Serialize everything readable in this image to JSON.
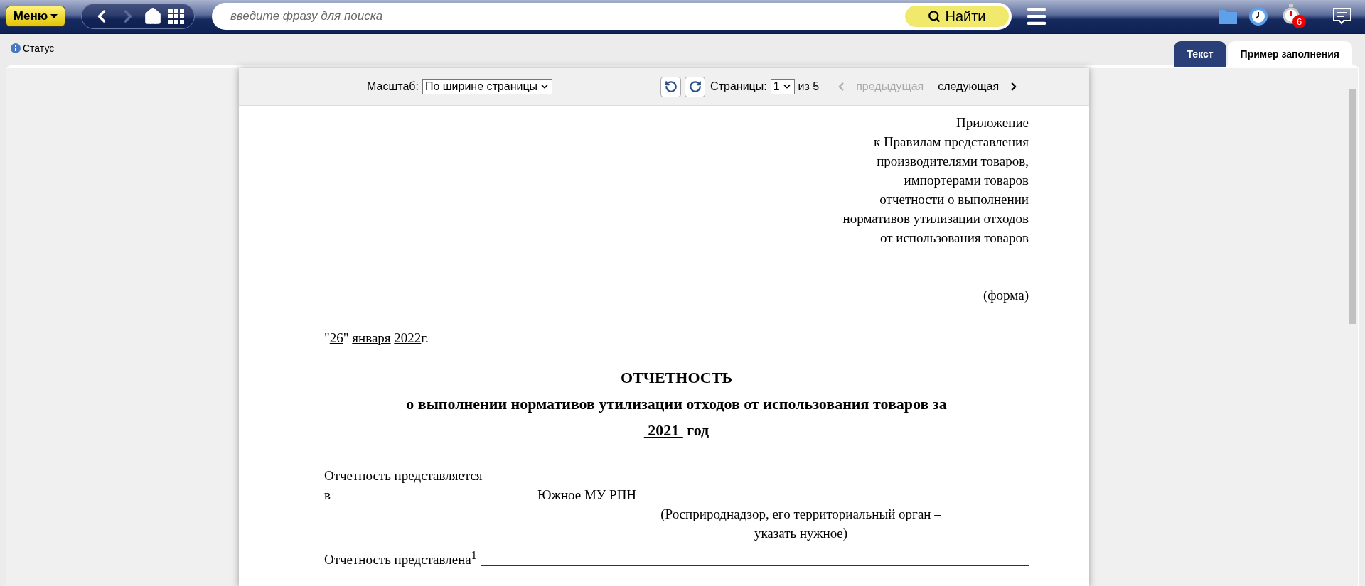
{
  "topbar": {
    "menu_button": "Меню",
    "search": {
      "placeholder": "введите фразу для поиска"
    },
    "search_button": "Найти",
    "timer_badge": "6"
  },
  "status_link": "Статус",
  "tabs": [
    {
      "label": "Текст",
      "selected": false
    },
    {
      "label": "Пример заполнения",
      "selected": true
    }
  ],
  "viewer_toolbar": {
    "zoom_label": "Масштаб:",
    "zoom_value": "По ширине страницы",
    "pages_label": "Страницы:",
    "page_value": "1",
    "page_total": "из 5",
    "prev": {
      "label": "предыдущая",
      "disabled": true
    },
    "next": {
      "label": "следующая",
      "disabled": false
    }
  },
  "document": {
    "appendix_lines": [
      "Приложение",
      "к Правилам представления",
      "производителями товаров,",
      "импортерами товаров",
      "отчетности о выполнении",
      "нормативов утилизации отходов",
      "от использования товаров"
    ],
    "form_label": "(форма)",
    "date_parts": [
      {
        "text": "\"",
        "underlined": false
      },
      {
        "text": "26",
        "underlined": true
      },
      {
        "text": "\" ",
        "underlined": false
      },
      {
        "text": "января",
        "underlined": true
      },
      {
        "text": "2022",
        "underlined": true
      },
      {
        "text": "г.",
        "underlined": false
      }
    ],
    "title": "ОТЧЕТНОСТЬ",
    "subtitle": "о выполнении нормативов утилизации отходов от использования товаров за",
    "year_parts": [
      {
        "text": " 2021 ",
        "underlined": true
      },
      {
        "text": " год",
        "underlined": false
      }
    ],
    "recipient_label_lines": [
      "Отчетность представляется",
      "в"
    ],
    "recipient_value": "Южное МУ РПН",
    "recipient_caption_lines": [
      "(Росприроднадзор, его территориальный орган –",
      "указать нужное)"
    ],
    "submitted_label": "Отчетность представлена$^{1}$"
  }
}
